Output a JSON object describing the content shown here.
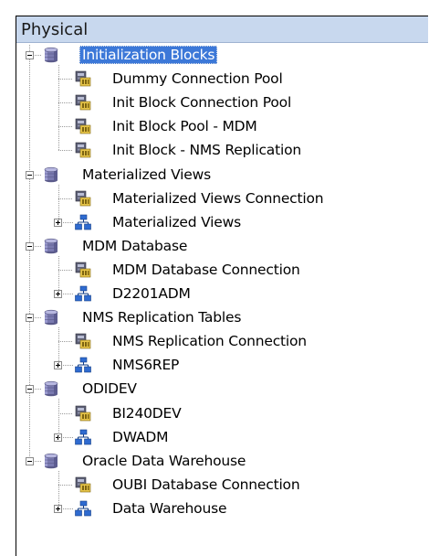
{
  "panel": {
    "title": "Physical"
  },
  "tree": [
    {
      "label": "Initialization Blocks",
      "selected": true,
      "children": [
        {
          "label": "Dummy Connection Pool",
          "type": "connection"
        },
        {
          "label": "Init Block Connection Pool",
          "type": "connection"
        },
        {
          "label": "Init Block Pool - MDM",
          "type": "connection"
        },
        {
          "label": "Init Block - NMS Replication",
          "type": "connection"
        }
      ]
    },
    {
      "label": "Materialized Views",
      "children": [
        {
          "label": "Materialized Views Connection",
          "type": "connection"
        },
        {
          "label": "Materialized Views",
          "type": "schema"
        }
      ]
    },
    {
      "label": "MDM Database",
      "children": [
        {
          "label": "MDM Database Connection",
          "type": "connection"
        },
        {
          "label": "D2201ADM",
          "type": "schema"
        }
      ]
    },
    {
      "label": "NMS Replication Tables",
      "children": [
        {
          "label": "NMS Replication Connection",
          "type": "connection"
        },
        {
          "label": "NMS6REP",
          "type": "schema"
        }
      ]
    },
    {
      "label": "ODIDEV",
      "children": [
        {
          "label": "BI240DEV",
          "type": "connection"
        },
        {
          "label": "DWADM",
          "type": "schema"
        }
      ]
    },
    {
      "label": "Oracle Data Warehouse",
      "children": [
        {
          "label": "OUBI Database Connection",
          "type": "connection"
        },
        {
          "label": "Data Warehouse",
          "type": "schema"
        }
      ]
    }
  ],
  "colors": {
    "header": "#c8d8ee",
    "selection": "#3c78d8"
  }
}
